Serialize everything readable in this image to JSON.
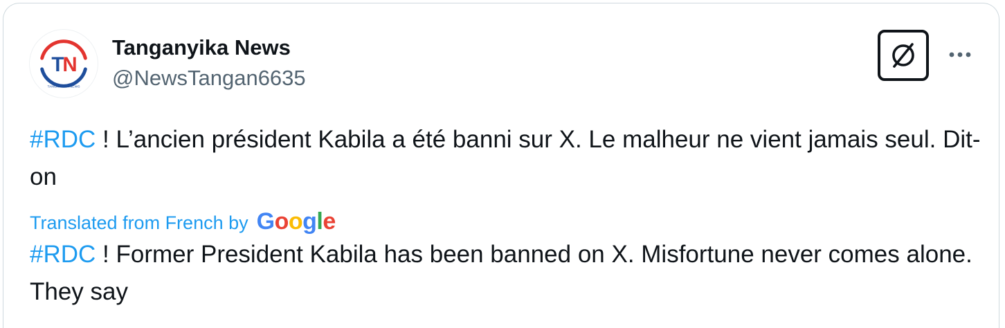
{
  "tweet": {
    "author": {
      "display_name": "Tanganyika News",
      "handle": "@NewsTangan6635",
      "avatar": {
        "initials": "TN",
        "caption": "TANGANYIKA NEWS",
        "colors": {
          "primary": "#e3342f",
          "secondary": "#1f4e9c"
        }
      }
    },
    "actions": {
      "grok_icon": "grok-slash-circle-icon",
      "more_icon": "more-horizontal-icon"
    },
    "original": {
      "hashtag": "#RDC",
      "text": " ! L’ancien président Kabila a été banni sur X. Le malheur ne vient jamais seul. Dit-on"
    },
    "translation_note": {
      "label": "Translated from French by",
      "provider": {
        "letters": [
          "G",
          "o",
          "o",
          "g",
          "l",
          "e"
        ],
        "colors": [
          "#4285f4",
          "#ea4335",
          "#fbbc05",
          "#4285f4",
          "#34a853",
          "#ea4335"
        ]
      }
    },
    "translated": {
      "hashtag": "#RDC",
      "text": " ! Former President Kabila has been banned on X. Misfortune never comes alone. They say"
    }
  },
  "colors": {
    "link": "#1d9bf0",
    "text": "#0f1419",
    "secondary_text": "#536471",
    "border": "#cfd9de"
  }
}
